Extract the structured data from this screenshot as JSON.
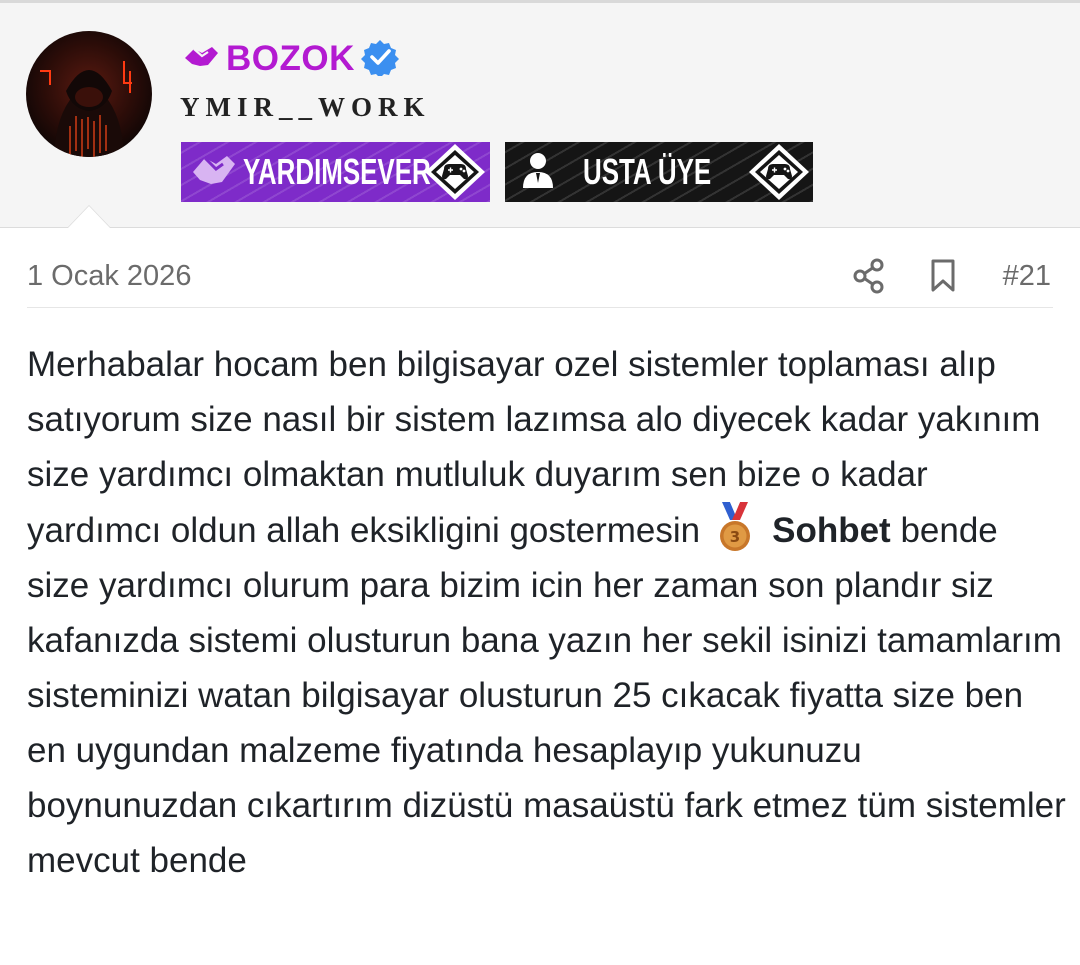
{
  "user": {
    "group_name": "BOZOK",
    "username": "YMIR__WORK",
    "badges": [
      {
        "label": "YARDIMSEVER",
        "color": "#7e2bc9"
      },
      {
        "label": "USTA ÜYE",
        "color": "#151515"
      }
    ],
    "group_color": "#b31ad1",
    "verified_color": "#3b8ff0"
  },
  "post": {
    "date": "1 Ocak 2026",
    "number": "#21",
    "text_before": "Merhabalar hocam ben bilgisayar ozel sistemler toplaması alıp satıyorum size nasıl bir sistem lazımsa alo diyecek kadar yakınım size yardımcı olmaktan mutluluk duyarım sen bize o kadar yardımcı oldun allah eksikligini gostermesin",
    "highlight": "Sohbet",
    "text_after": "bende size yardımcı olurum para bizim icin her zaman son plandır siz kafanızda sistemi olusturun bana yazın her sekil isinizi tamamlarım sisteminizi watan bilgisayar olusturun 25 cıkacak fiyatta size ben en uygundan malzeme fiyatında hesaplayıp yukunuzu boynunuzdan cıkartırım dizüstü masaüstü fark etmez tüm sistemler mevcut bende"
  },
  "icons": {
    "share": "share-icon",
    "bookmark": "bookmark-icon",
    "medal": "third-place-medal-icon",
    "gamepad": "gamepad-diamond-icon",
    "handshake": "handshake-icon",
    "person": "person-icon"
  }
}
